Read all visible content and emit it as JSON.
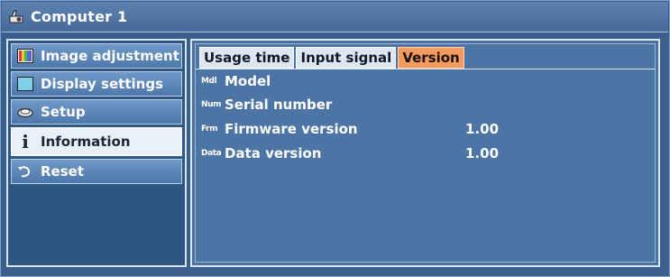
{
  "window": {
    "title": "Computer 1",
    "title_icon": "projector-icon"
  },
  "sidebar": {
    "items": [
      {
        "label": "Image adjustment",
        "icon": "palette-icon"
      },
      {
        "label": "Display settings",
        "icon": "screen-icon"
      },
      {
        "label": "Setup",
        "icon": "setup-icon"
      },
      {
        "label": "Information",
        "icon": "info-icon",
        "active": true
      },
      {
        "label": "Reset",
        "icon": "undo-icon"
      }
    ]
  },
  "tabs": [
    {
      "label": "Usage time"
    },
    {
      "label": "Input signal"
    },
    {
      "label": "Version",
      "active": true
    }
  ],
  "info_rows": [
    {
      "abbr": "Mdl",
      "label": "Model",
      "value": ""
    },
    {
      "abbr": "Num",
      "label": "Serial number",
      "value": ""
    },
    {
      "abbr": "Frm",
      "label": "Firmware version",
      "value": "1.00"
    },
    {
      "abbr": "Data",
      "label": "Data version",
      "value": "1.00"
    }
  ],
  "colors": {
    "accent_tab": "#f39a5f",
    "background": "#3a5f8c",
    "active_item": "#e9f0f8"
  }
}
